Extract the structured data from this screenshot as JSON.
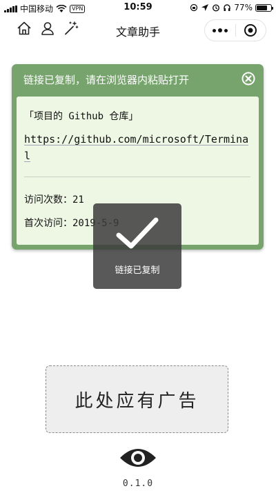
{
  "status_bar": {
    "carrier": "中国移动",
    "vpn": "VPN",
    "time": "10:59",
    "battery": "77%",
    "battery_level": 0.77
  },
  "nav": {
    "title": "文章助手",
    "icons": [
      "home-icon",
      "user-icon",
      "magic-wand-icon"
    ],
    "capsule": [
      "more-icon",
      "close-miniprogram-icon"
    ]
  },
  "card": {
    "header": "链接已复制，请在浏览器内粘贴打开",
    "close_icon": "close-circle-icon",
    "title": "「项目的 Github 仓库」",
    "url": "https://github.com/microsoft/Terminal",
    "visits_label": "访问次数：",
    "visits_value": "21",
    "first_visit_label": "首次访问：",
    "first_visit_value": "2019-5-9",
    "colors": {
      "header_bg": "#76a46c",
      "body_bg": "#eef6e4"
    }
  },
  "toast": {
    "icon": "checkmark-icon",
    "text": "链接已复制"
  },
  "ad": {
    "text": "此处应有广告"
  },
  "footer": {
    "icon": "eye-icon",
    "version": "0.1.0"
  }
}
